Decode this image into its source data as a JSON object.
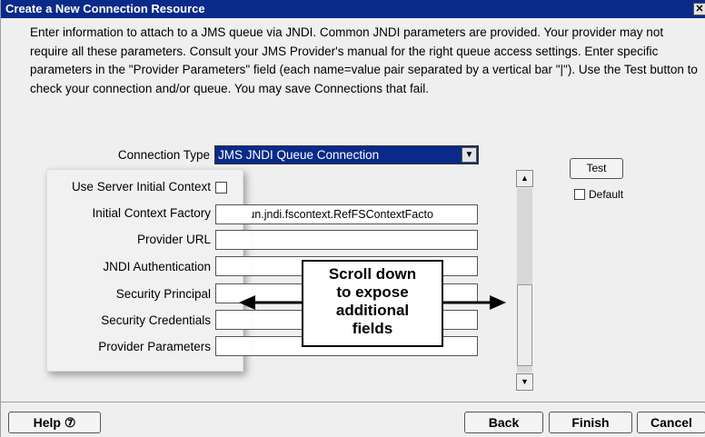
{
  "window": {
    "title": "Create a New Connection Resource",
    "close_glyph": "✕"
  },
  "intro_text": "Enter information to attach to a JMS queue via JNDI. Common JNDI parameters are provided. Your provider may not require all these parameters. Consult your JMS Provider's manual for the right queue access settings. Enter specific parameters in the \"Provider Parameters\" field (each name=value pair separated by a vertical bar \"|\"). Use the Test button to check your connection and/or queue. You may save Connections that fail.",
  "connection_type": {
    "label": "Connection Type",
    "selected": "JMS JNDI Queue Connection",
    "arrow": "▼"
  },
  "fields": {
    "use_server_context": {
      "label": "Use Server Initial Context",
      "checked": false
    },
    "initial_context_factory": {
      "label": "Initial Context Factory",
      "value": "com.sun.jndi.fscontext.RefFSContextFacto"
    },
    "provider_url": {
      "label": "Provider URL",
      "value": ""
    },
    "jndi_authentication": {
      "label": "JNDI Authentication",
      "value": ""
    },
    "security_principal": {
      "label": "Security Principal",
      "value": ""
    },
    "security_credentials": {
      "label": "Security Credentials",
      "value": ""
    },
    "provider_parameters": {
      "label": "Provider Parameters",
      "value": ""
    }
  },
  "annotation": {
    "line1": "Scroll down",
    "line2": "to expose",
    "line3": "additional",
    "line4": "fields"
  },
  "scrollbar": {
    "up_glyph": "▲",
    "down_glyph": "▼"
  },
  "side": {
    "test_label": "Test",
    "default_label": "Default",
    "default_checked": false
  },
  "footer": {
    "help_label": "Help ⑦",
    "back_label": "Back",
    "finish_label": "Finish",
    "cancel_label": "Cancel"
  }
}
